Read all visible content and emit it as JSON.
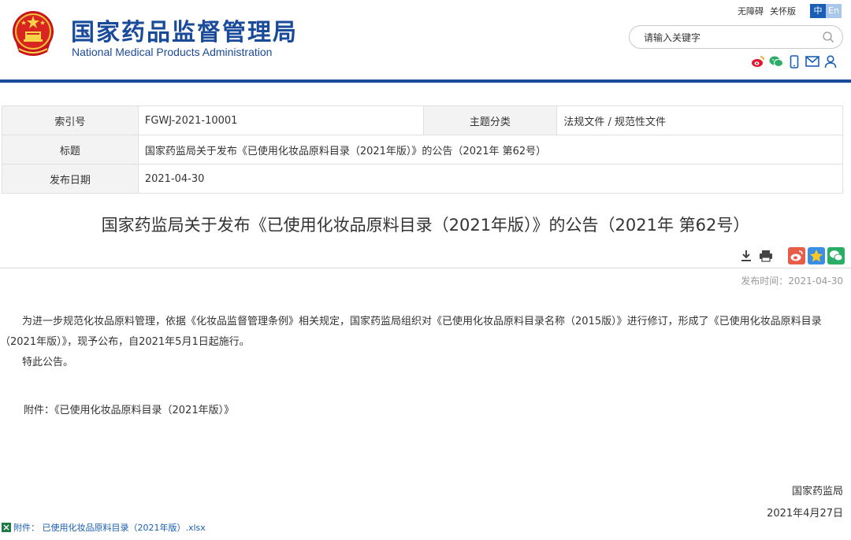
{
  "header": {
    "logo_cn": "国家药品监督管理局",
    "logo_en": "National Medical Products Administration",
    "toplinks": [
      "无障碍",
      "关怀版"
    ],
    "lang_zh": "中",
    "lang_en": "En",
    "search_placeholder": "请输入关键字",
    "social_icons": [
      "weibo-icon",
      "wechat-icon",
      "mobile-icon",
      "mail-icon",
      "user-icon"
    ],
    "brand_color": "#1a4a9a"
  },
  "meta": {
    "index_label": "索引号",
    "index_value": "FGWJ-2021-10001",
    "category_label": "主题分类",
    "category_value": "法规文件 / 规范性文件",
    "title_label": "标题",
    "title_value": "国家药监局关于发布《已使用化妆品原料目录（2021年版）》的公告（2021年 第62号）",
    "date_label": "发布日期",
    "date_value": "2021-04-30"
  },
  "article": {
    "title": "国家药监局关于发布《已使用化妆品原料目录（2021年版）》的公告（2021年 第62号）",
    "tools": [
      "download-icon",
      "print-icon",
      "weibo-share-icon",
      "qzone-share-icon",
      "wechat-share-icon"
    ],
    "pubtime": "发布时间：2021-04-30",
    "para1": "为进一步规范化妆品原料管理，依据《化妆品监督管理条例》相关规定，国家药监局组织对《已使用化妆品原料目录名称（2015版）》进行修订，形成了《已使用化妆品原料目录（2021年版）》，现予公布，自2021年5月1日起施行。",
    "para2": "特此公告。",
    "attachment_line": "附件：《已使用化妆品原料目录（2021年版）》",
    "sign_org": "国家药监局",
    "sign_date": "2021年4月27日",
    "file_link": "附件： 已使用化妆品原料目录（2021年版）.xlsx"
  }
}
